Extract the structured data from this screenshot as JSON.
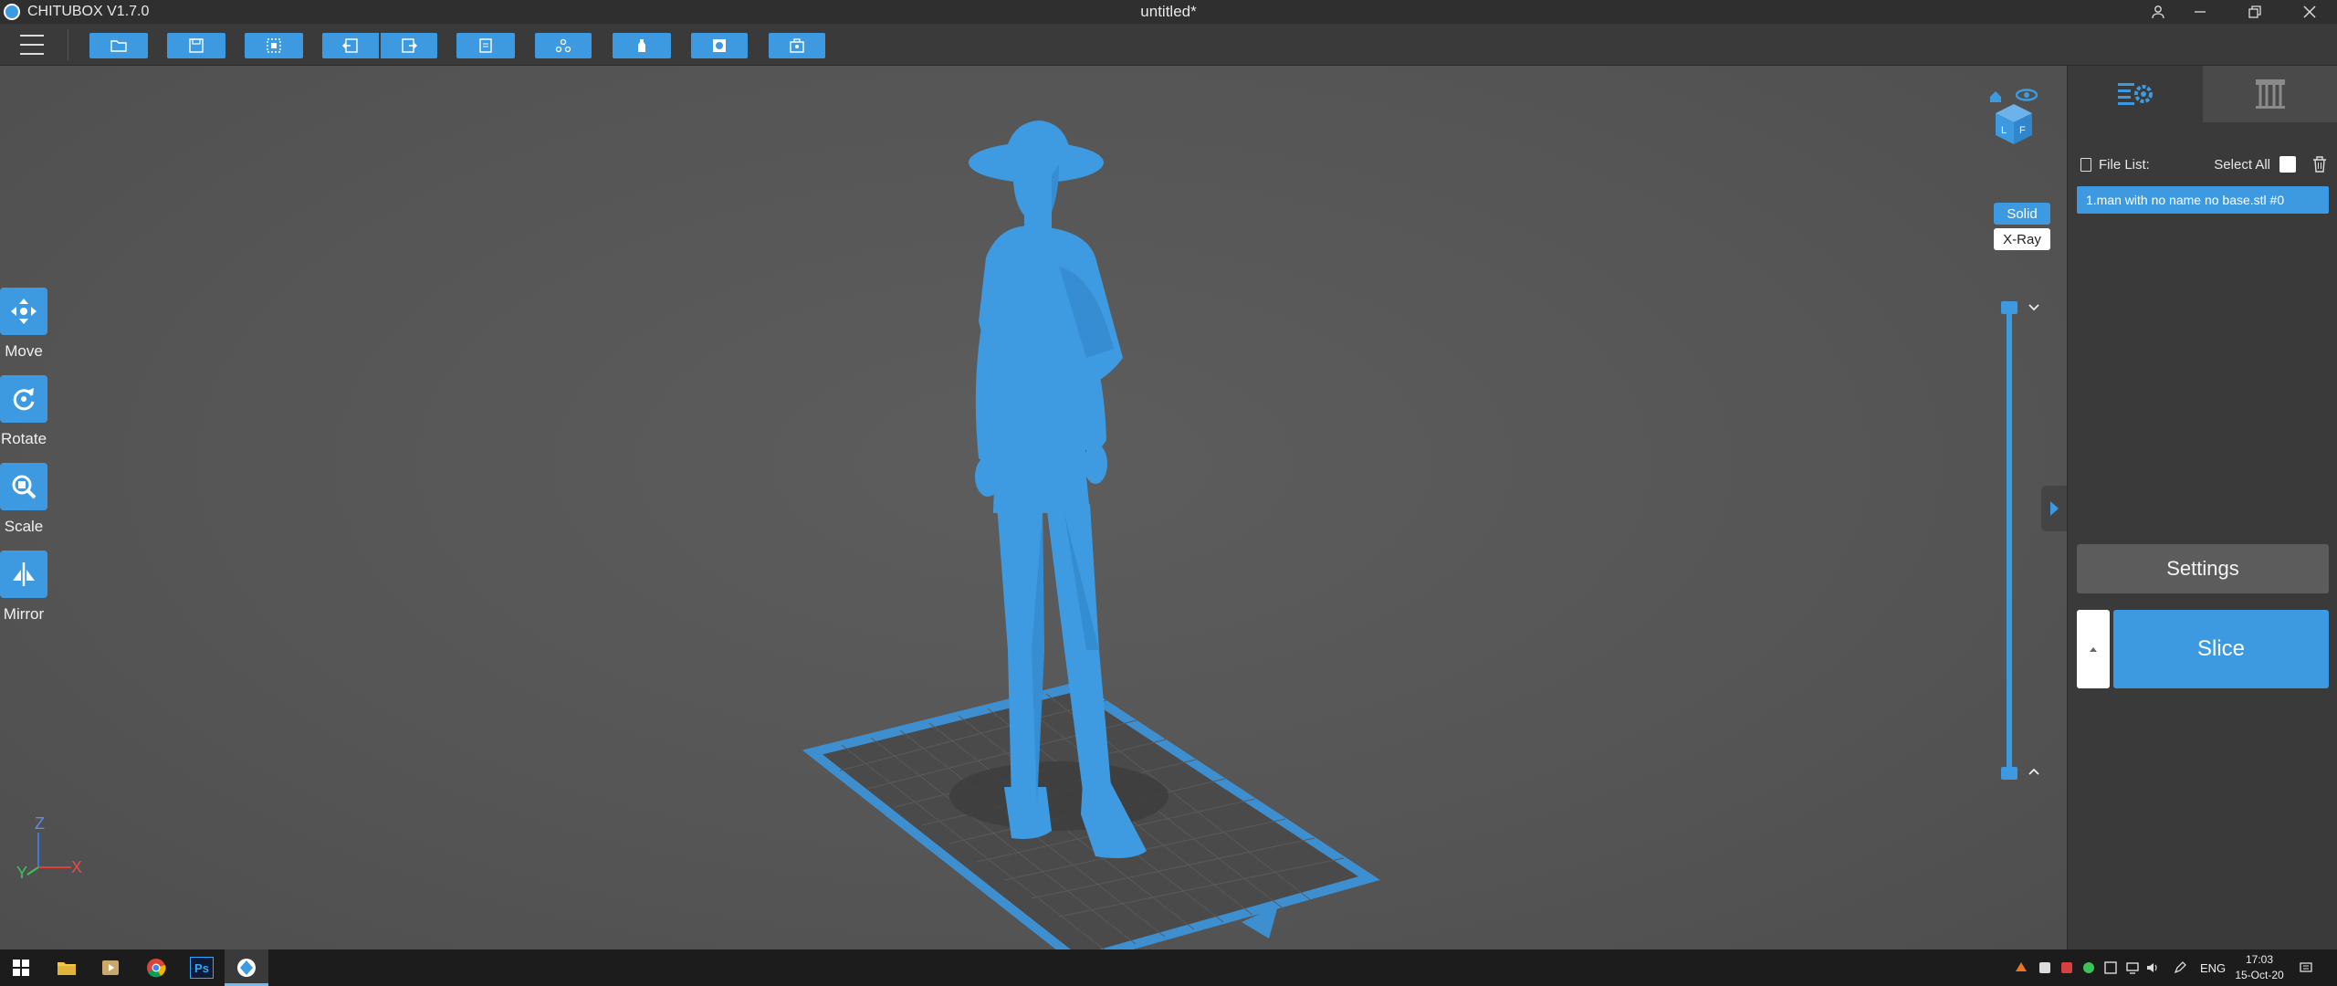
{
  "window": {
    "app_name": "CHITUBOX V1.7.0",
    "document_title": "untitled*"
  },
  "toolbar": {
    "buttons": [
      {
        "name": "open-file-button",
        "icon": "folder-icon"
      },
      {
        "name": "save-button",
        "icon": "save-icon"
      },
      {
        "name": "select-all-button",
        "icon": "select-icon"
      },
      {
        "name": "undo-button",
        "icon": "undo-icon"
      },
      {
        "name": "redo-button",
        "icon": "redo-icon"
      },
      {
        "name": "copy-button",
        "icon": "copy-icon"
      },
      {
        "name": "layout-button",
        "icon": "layout-icon"
      },
      {
        "name": "support-button",
        "icon": "bottle-icon"
      },
      {
        "name": "hollow-button",
        "icon": "hollow-icon"
      },
      {
        "name": "drill-button",
        "icon": "drill-icon"
      }
    ]
  },
  "side_tools": [
    {
      "label": "Move",
      "icon": "move-icon"
    },
    {
      "label": "Rotate",
      "icon": "rotate-icon"
    },
    {
      "label": "Scale",
      "icon": "scale-icon"
    },
    {
      "label": "Mirror",
      "icon": "mirror-icon"
    }
  ],
  "axis": {
    "z": "Z",
    "y": "Y",
    "x": "X"
  },
  "render_modes": {
    "solid": "Solid",
    "xray": "X-Ray",
    "active": "Solid"
  },
  "right_panel": {
    "file_list_label": "File List:",
    "select_all_label": "Select All",
    "files": [
      "1.man with no name no base.stl #0"
    ],
    "settings_label": "Settings",
    "slice_label": "Slice"
  },
  "taskbar": {
    "apps": [
      "start-icon",
      "file-explorer-icon",
      "media-player-icon",
      "chrome-icon",
      "photoshop-icon",
      "chitubox-icon"
    ],
    "photoshop_text": "Ps",
    "language": "ENG",
    "time": "17:03",
    "date": "15-Oct-20"
  },
  "colors": {
    "accent": "#3d9ae0",
    "viewport_bg": "#575757",
    "panel_bg": "#3a3a3a",
    "model": "#3e9be2"
  }
}
